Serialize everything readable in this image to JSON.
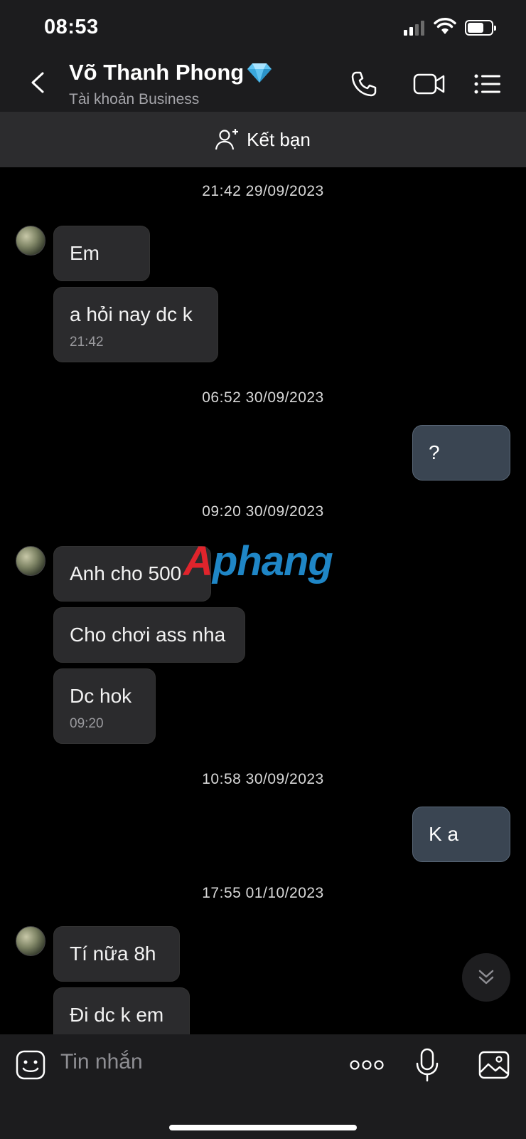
{
  "status_bar": {
    "time": "08:53",
    "battery_level": 0.7
  },
  "header": {
    "contact_name": "Võ Thanh Phong",
    "contact_subtitle": "Tài khoản Business",
    "badge_icon": "diamond-icon",
    "actions": [
      "phone-icon",
      "video-call-icon",
      "menu-list-icon"
    ]
  },
  "friend_bar": {
    "label": "Kết bạn",
    "icon": "add-person-icon"
  },
  "watermark": {
    "part1": "A",
    "part2": "phang"
  },
  "messages": [
    {
      "type": "timestamp",
      "text": "21:42 29/09/2023"
    },
    {
      "type": "incoming",
      "text": "Em"
    },
    {
      "type": "incoming",
      "text": "a hỏi nay dc k",
      "time": "21:42"
    },
    {
      "type": "timestamp",
      "text": "06:52 30/09/2023"
    },
    {
      "type": "outgoing",
      "text": "?"
    },
    {
      "type": "timestamp",
      "text": "09:20 30/09/2023"
    },
    {
      "type": "incoming",
      "text": "Anh cho 500"
    },
    {
      "type": "incoming",
      "text": "Cho chơi ass nha"
    },
    {
      "type": "incoming",
      "text": "Dc hok",
      "time": "09:20"
    },
    {
      "type": "timestamp",
      "text": "10:58 30/09/2023"
    },
    {
      "type": "outgoing",
      "text": "K a"
    },
    {
      "type": "timestamp",
      "text": "17:55 01/10/2023"
    },
    {
      "type": "incoming",
      "text": "Tí nữa 8h"
    },
    {
      "type": "incoming",
      "text": "Đi dc k em"
    }
  ],
  "input_bar": {
    "placeholder": "Tin nhắn",
    "icons": [
      "emoji-icon",
      "more-icon",
      "microphone-icon",
      "image-icon"
    ]
  },
  "colors": {
    "incoming_bubble": "#2b2b2d",
    "outgoing_bubble": "#3a4552",
    "header": "#1c1c1e"
  }
}
